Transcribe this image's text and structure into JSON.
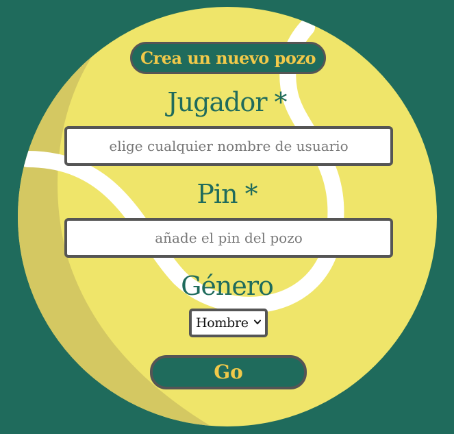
{
  "colors": {
    "background": "#1f6b5c",
    "ball": "#efe56a",
    "ball_shadow": "#d4c862",
    "seam": "#ffffff",
    "accent": "#f1c94a",
    "border": "#555555",
    "label": "#1f6b5c"
  },
  "header": {
    "title": "Crea un nuevo pozo"
  },
  "form": {
    "player_label": "Jugador *",
    "player_placeholder": "elige cualquier nombre de usuario",
    "pin_label": "Pin *",
    "pin_placeholder": "añade el pin del pozo",
    "gender_label": "Género",
    "gender_selected": "Hombre",
    "submit_label": "Go"
  },
  "icons": {
    "ball": "tennis-ball-icon",
    "chevron": "chevron-down-icon"
  }
}
